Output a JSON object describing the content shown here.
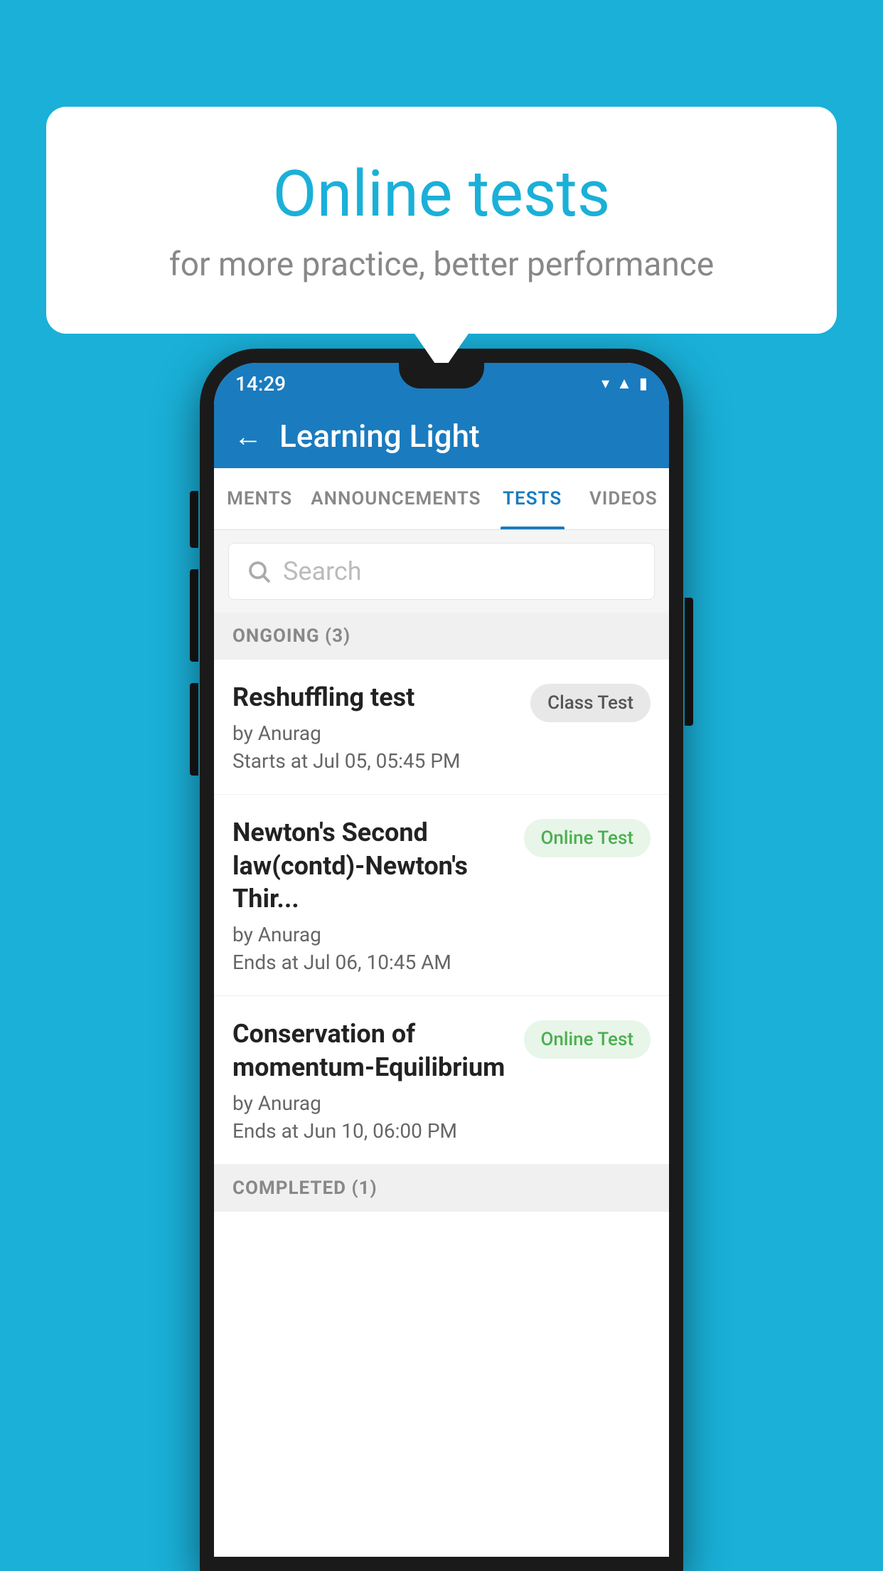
{
  "background_color": "#1ab0d8",
  "speech_bubble": {
    "title": "Online tests",
    "subtitle": "for more practice, better performance"
  },
  "status_bar": {
    "time": "14:29",
    "icons": [
      "wifi",
      "signal",
      "battery"
    ]
  },
  "app_bar": {
    "title": "Learning Light",
    "back_label": "←"
  },
  "tabs": [
    {
      "label": "MENTS",
      "active": false
    },
    {
      "label": "ANNOUNCEMENTS",
      "active": false
    },
    {
      "label": "TESTS",
      "active": true
    },
    {
      "label": "VIDEOS",
      "active": false
    }
  ],
  "search": {
    "placeholder": "Search"
  },
  "sections": [
    {
      "header": "ONGOING (3)",
      "tests": [
        {
          "name": "Reshuffling test",
          "author": "by Anurag",
          "time_label": "Starts at",
          "time": "Jul 05, 05:45 PM",
          "badge": "Class Test",
          "badge_type": "class"
        },
        {
          "name": "Newton's Second law(contd)-Newton's Thir...",
          "author": "by Anurag",
          "time_label": "Ends at",
          "time": "Jul 06, 10:45 AM",
          "badge": "Online Test",
          "badge_type": "online"
        },
        {
          "name": "Conservation of momentum-Equilibrium",
          "author": "by Anurag",
          "time_label": "Ends at",
          "time": "Jun 10, 06:00 PM",
          "badge": "Online Test",
          "badge_type": "online"
        }
      ]
    }
  ],
  "completed_header": "COMPLETED (1)"
}
